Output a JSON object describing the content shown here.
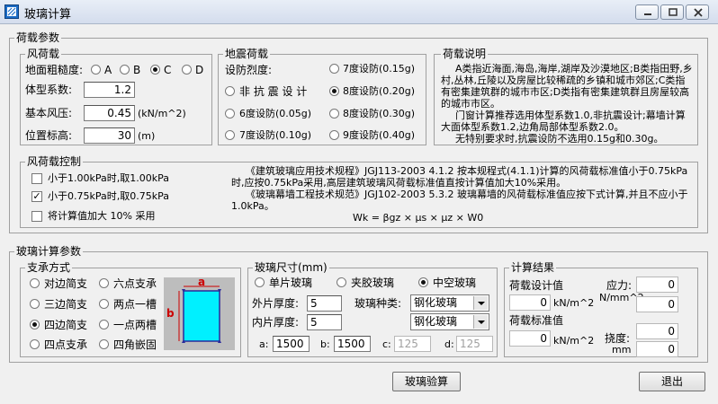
{
  "window": {
    "title": "玻璃计算"
  },
  "load": {
    "group": "荷载参数",
    "wind": {
      "group": "风荷载",
      "roughness_label": "地面粗糙度:",
      "roughness_options": [
        "A",
        "B",
        "C",
        "D"
      ],
      "roughness_selected": "C",
      "shape_label": "体型系数:",
      "shape_value": "1.2",
      "pressure_label": "基本风压:",
      "pressure_value": "0.45",
      "pressure_unit": "(kN/m^2)",
      "height_label": "位置标高:",
      "height_value": "30",
      "height_unit": "(m)"
    },
    "seismic": {
      "group": "地震荷载",
      "intensity_label": "设防烈度:",
      "options": [
        "7度设防(0.15g)",
        "非 抗 震 设 计",
        "8度设防(0.20g)",
        "6度设防(0.05g)",
        "8度设防(0.30g)",
        "7度设防(0.10g)",
        "9度设防(0.40g)"
      ],
      "selected": "8度设防(0.20g)"
    },
    "notes": {
      "group": "荷载说明",
      "text1": "A类指近海面,海岛,海岸,湖岸及沙漠地区;B类指田野,乡村,丛林,丘陵以及房屋比较稀疏的乡镇和城市郊区;C类指有密集建筑群的城市市区;D类指有密集建筑群且房屋较高的城市市区。",
      "text2": "门窗计算推荐选用体型系数1.0,非抗震设计;幕墙计算大面体型系数1.2,边角局部体型系数2.0。",
      "text3": "无特别要求时,抗震设防不选用0.15g和0.30g。"
    },
    "control": {
      "group": "风荷载控制",
      "checks": [
        {
          "label": "小于1.00kPa时,取1.00kPa",
          "checked": false
        },
        {
          "label": "小于0.75kPa时,取0.75kPa",
          "checked": true
        },
        {
          "label": "将计算值加大 10% 采用",
          "checked": false
        }
      ],
      "text1": "《建筑玻璃应用技术规程》JGJ113-2003  4.1.2 按本规程式(4.1.1)计算的风荷载标准值小于0.75kPa时,应按0.75kPa采用,高层建筑玻璃风荷载标准值直按计算值加大10%采用。",
      "text2": "《玻璃幕墙工程技术规范》JGJ102-2003  5.3.2 玻璃幕墙的风荷载标准值应按下式计算,并且不应小于1.0kPa。",
      "formula": "Wk = βgz × μs × μz × W0"
    }
  },
  "glass": {
    "group": "玻璃计算参数",
    "support": {
      "group": "支承方式",
      "options": [
        "对边简支",
        "六点支承",
        "三边简支",
        "两点一槽",
        "四边简支",
        "一点两槽",
        "四点支承",
        "四角嵌固"
      ],
      "selected": "四边简支",
      "dim_a": "a",
      "dim_b": "b"
    },
    "size": {
      "group": "玻璃尺寸(mm)",
      "types": [
        "单片玻璃",
        "夹胶玻璃",
        "中空玻璃"
      ],
      "type_selected": "中空玻璃",
      "outer_label": "外片厚度:",
      "outer_value": "5",
      "inner_label": "内片厚度:",
      "inner_value": "5",
      "kind_label": "玻璃种类:",
      "kind_outer": "钢化玻璃",
      "kind_inner": "钢化玻璃",
      "a_label": "a:",
      "a_value": "1500",
      "b_label": "b:",
      "b_value": "1500",
      "c_label": "c:",
      "c_value": "125",
      "d_label": "d:",
      "d_value": "125"
    },
    "result": {
      "group": "计算结果",
      "design_label": "荷载设计值",
      "design_value": "0",
      "design_unit": "kN/m^2",
      "std_label": "荷载标准值",
      "std_value": "0",
      "std_unit": "kN/m^2",
      "stress_label": "应力:",
      "stress_unit": "N/mm^2",
      "stress_value1": "0",
      "stress_value2": "0",
      "deflection_label": "挠度:",
      "deflection_unit": "mm",
      "deflection_value1": "0",
      "deflection_value2": "0"
    }
  },
  "buttons": {
    "check": "玻璃验算",
    "exit": "退出"
  }
}
